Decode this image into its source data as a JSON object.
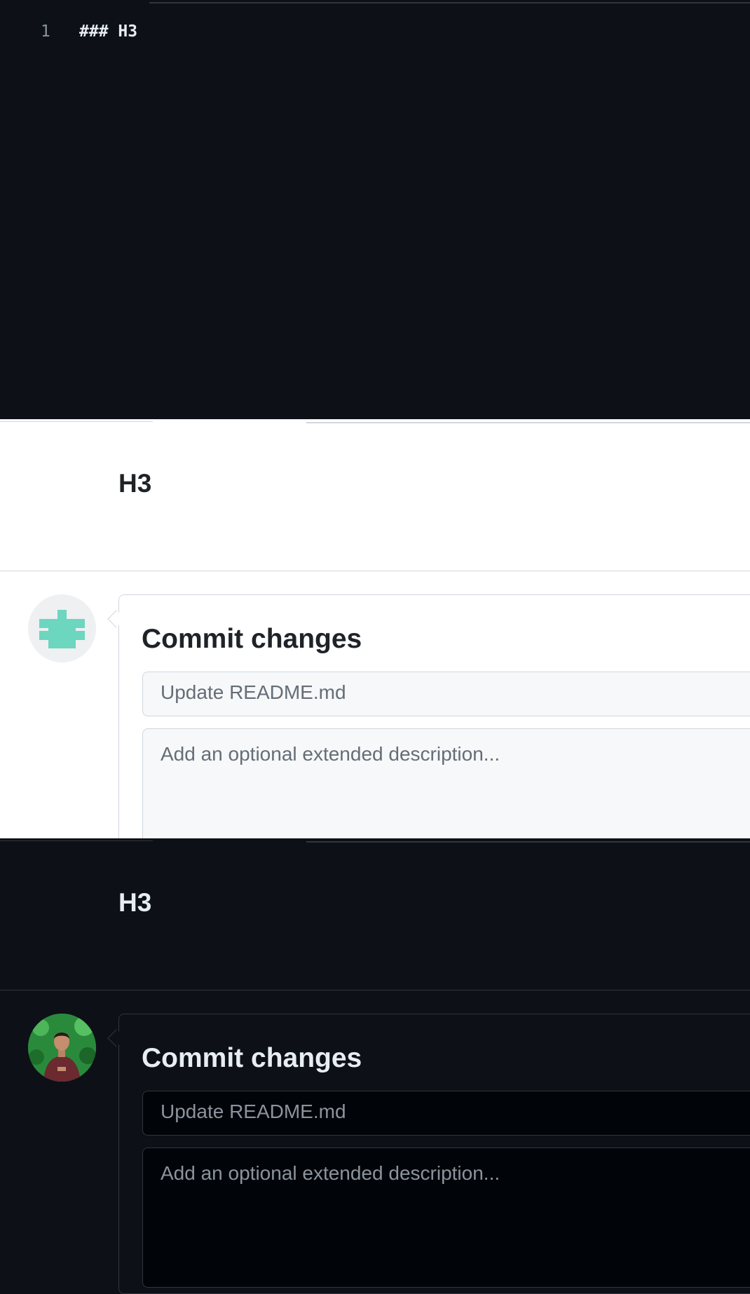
{
  "editor": {
    "line_number": "1",
    "line_code": "### H3"
  },
  "light_panel": {
    "preview_heading": "H3",
    "commit": {
      "title": "Commit changes",
      "summary_placeholder": "Update README.md",
      "description_placeholder": "Add an optional extended description..."
    },
    "avatar": "identicon-avatar"
  },
  "dark_panel": {
    "preview_heading": "H3",
    "commit": {
      "title": "Commit changes",
      "summary_placeholder": "Update README.md",
      "description_placeholder": "Add an optional extended description..."
    },
    "avatar": "user-photo-avatar"
  },
  "colors": {
    "dark_bg": "#0d1117",
    "light_bg": "#ffffff",
    "identicon": "#6cd6bf",
    "avatar_green": "#1f7a33"
  }
}
